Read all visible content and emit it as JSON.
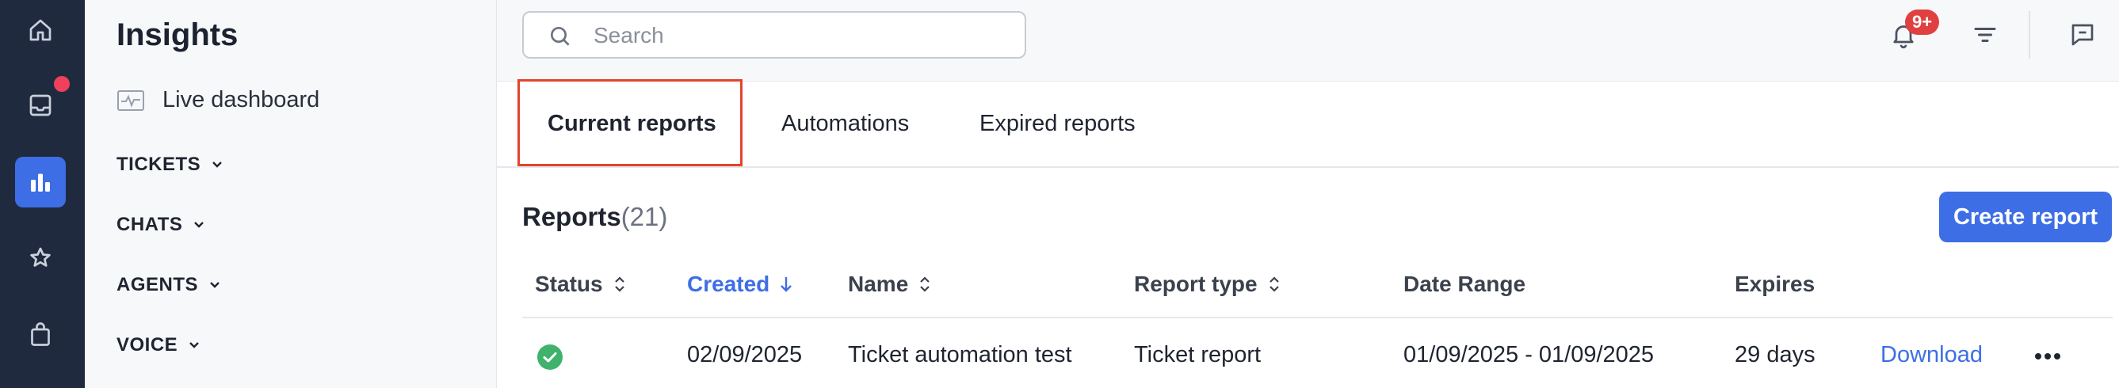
{
  "rail": {
    "items": [
      {
        "icon": "home-icon"
      },
      {
        "icon": "inbox-icon",
        "has_notification_dot": true
      },
      {
        "icon": "insights-chart-icon",
        "active": true
      },
      {
        "icon": "star-icon"
      },
      {
        "icon": "shopping-bag-icon"
      }
    ],
    "colors": {
      "background": "#1f2a3f",
      "active": "#3e6ee6",
      "dot": "#f0405c"
    }
  },
  "subnav": {
    "title": "Insights",
    "live_dashboard": "Live dashboard",
    "groups": [
      "TICKETS",
      "CHATS",
      "AGENTS",
      "VOICE"
    ]
  },
  "topbar": {
    "search_placeholder": "Search",
    "search_value": "",
    "notifications_badge": "9+"
  },
  "tabs": [
    {
      "label": "Current reports",
      "active": true
    },
    {
      "label": "Automations",
      "active": false
    },
    {
      "label": "Expired reports",
      "active": false
    }
  ],
  "reports": {
    "title": "Reports",
    "count": "(21)",
    "create_button": "Create report",
    "columns": [
      "Status",
      "Created",
      "Name",
      "Report type",
      "Date Range",
      "Expires"
    ],
    "sorted_column": "Created",
    "sort_direction": "descending",
    "rows": [
      {
        "status": "success",
        "created": "02/09/2025",
        "name": "Ticket automation test",
        "report_type": "Ticket report",
        "date_range": "01/09/2025 - 01/09/2025",
        "expires": "29 days",
        "action": "Download"
      }
    ]
  },
  "colors": {
    "accent": "#3e6ee6",
    "badge": "#e04040",
    "success": "#3fb26b",
    "highlight_outline": "#e2442a"
  }
}
